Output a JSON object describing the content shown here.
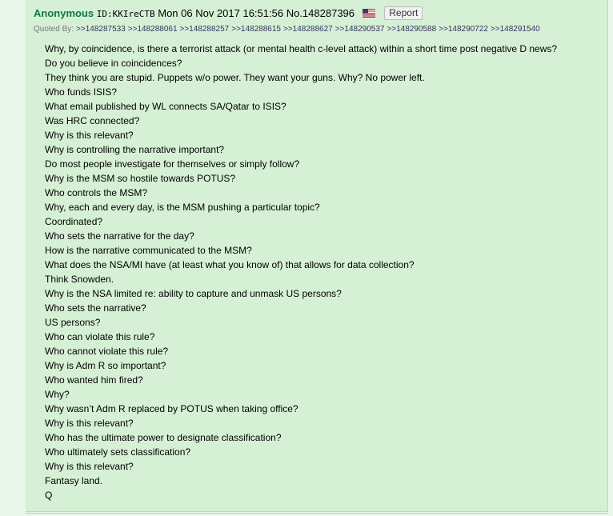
{
  "post": {
    "name": "Anonymous",
    "id_label": "ID:KKIreCTB",
    "datetime": "Mon 06 Nov 2017 16:51:56",
    "number": "No.148287396",
    "report_label": "Report",
    "quoted_by_label": "Quoted By:",
    "quoted_by": [
      ">>148287533",
      ">>148288061",
      ">>148288257",
      ">>148288615",
      ">>148288627",
      ">>148290537",
      ">>148290588",
      ">>148290722",
      ">>148291540"
    ],
    "lines": [
      "Why, by coincidence, is there a terrorist attack (or mental health c-level attack) within a short time post negative D news?",
      "Do you believe in coincidences?",
      "They think you are stupid. Puppets w/o power. They want your guns. Why? No power left.",
      "Who funds ISIS?",
      "What email published by WL connects SA/Qatar to ISIS?",
      "Was HRC connected?",
      "Why is this relevant?",
      "Why is controlling the narrative important?",
      "Do most people investigate for themselves or simply follow?",
      "Why is the MSM so hostile towards POTUS?",
      "Who controls the MSM?",
      "Why, each and every day, is the MSM pushing a particular topic?",
      "Coordinated?",
      "Who sets the narrative for the day?",
      "How is the narrative communicated to the MSM?",
      "What does the NSA/MI have (at least what you know of) that allows for data collection?",
      "Think Snowden.",
      "Why is the NSA limited re: ability to capture and unmask US persons?",
      "Who sets the narrative?",
      "US persons?",
      "Who can violate this rule?",
      "Who cannot violate this rule?",
      "Why is Adm R so important?",
      "Who wanted him fired?",
      "Why?",
      "Why wasn’t Adm R replaced by POTUS when taking office?",
      "Why is this relevant?",
      "Who has the ultimate power to designate classification?",
      "Who ultimately sets classification?",
      "Why is this relevant?",
      "Fantasy land.",
      "Q"
    ]
  },
  "colors": {
    "page_bg": "#e8f5e8",
    "post_bg": "#d6f0d6",
    "name": "#117743",
    "quote_link": "#34345c"
  },
  "icons": {
    "flag": "us-flag-icon"
  }
}
